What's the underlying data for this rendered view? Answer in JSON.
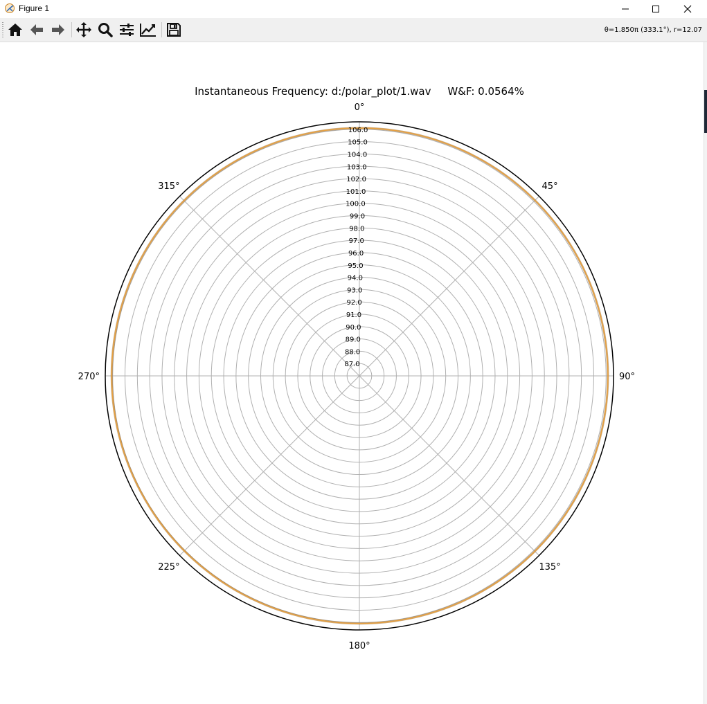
{
  "window": {
    "title": "Figure 1",
    "minimize_icon": "minimize-icon",
    "maximize_icon": "maximize-icon",
    "close_icon": "close-icon"
  },
  "toolbar": {
    "buttons": [
      {
        "name": "home-button",
        "icon": "home-icon"
      },
      {
        "name": "back-button",
        "icon": "arrow-left-icon"
      },
      {
        "name": "forward-button",
        "icon": "arrow-right-icon"
      },
      {
        "name": "pan-button",
        "icon": "move-icon"
      },
      {
        "name": "zoom-button",
        "icon": "magnifier-icon"
      },
      {
        "name": "configure-subplots-button",
        "icon": "sliders-icon"
      },
      {
        "name": "edit-axis-button",
        "icon": "line-chart-icon"
      },
      {
        "name": "save-button",
        "icon": "floppy-disk-icon"
      }
    ],
    "coords": "θ=1.850π (333.1°), r=12.07"
  },
  "chart_data": {
    "type": "polar",
    "title": "Instantaneous Frequency: d:/polar_plot/1.wav     W&F: 0.0564%",
    "theta_direction": "clockwise",
    "theta_zero": "top",
    "theta_ticks": [
      "0°",
      "45°",
      "90°",
      "135°",
      "180°",
      "225°",
      "270°",
      "315°"
    ],
    "theta_tick_degrees": [
      0,
      45,
      90,
      135,
      180,
      225,
      270,
      315
    ],
    "r_ticks": [
      "87.0",
      "88.0",
      "89.0",
      "90.0",
      "91.0",
      "92.0",
      "93.0",
      "94.0",
      "95.0",
      "96.0",
      "97.0",
      "98.0",
      "99.0",
      "100.0",
      "101.0",
      "102.0",
      "103.0",
      "104.0",
      "105.0",
      "106.0"
    ],
    "rlim": [
      86.0,
      106.6
    ],
    "grid": true,
    "series": [
      {
        "color": "#e6a040",
        "theta_degrees": [
          0,
          30,
          60,
          90,
          120,
          150,
          180,
          210,
          240,
          270,
          300,
          330,
          360
        ],
        "values": [
          106.1,
          106.12,
          106.14,
          106.15,
          106.13,
          106.1,
          106.08,
          106.07,
          106.06,
          106.08,
          106.1,
          106.1,
          106.1
        ]
      }
    ]
  }
}
